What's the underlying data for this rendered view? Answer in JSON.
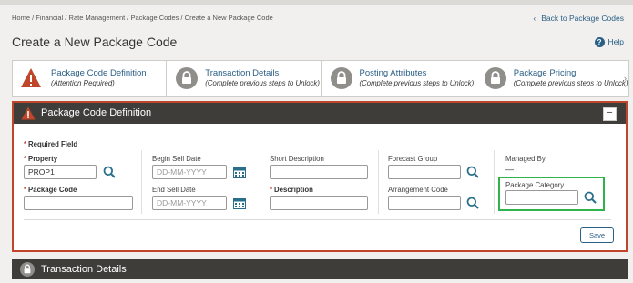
{
  "breadcrumb": "Home / Financial / Rate Management / Package Codes / Create a New Package Code",
  "back_link": "Back to Package Codes",
  "page_title": "Create a New Package Code",
  "help_label": "Help",
  "steps": [
    {
      "label": "Package Code Definition",
      "sub": "(Attention Required)",
      "icon": "warning-icon"
    },
    {
      "label": "Transaction Details",
      "sub": "(Complete previous steps to Unlock)",
      "icon": "lock-icon"
    },
    {
      "label": "Posting Attributes",
      "sub": "(Complete previous steps to Unlock)",
      "icon": "lock-icon"
    },
    {
      "label": "Package Pricing",
      "sub": "(Complete previous steps to Unlock)",
      "icon": "lock-icon"
    }
  ],
  "panel": {
    "title": "Package Code Definition",
    "required_note": "Required Field",
    "property_label": "Property",
    "property_value": "PROP1",
    "package_code_label": "Package Code",
    "package_code_value": "",
    "begin_sell_label": "Begin Sell Date",
    "begin_sell_placeholder": "DD-MM-YYYY",
    "end_sell_label": "End Sell Date",
    "end_sell_placeholder": "DD-MM-YYYY",
    "short_desc_label": "Short Description",
    "description_label": "Description",
    "forecast_group_label": "Forecast Group",
    "arrangement_code_label": "Arrangement Code",
    "managed_by_label": "Managed By",
    "managed_by_value": "—",
    "package_category_label": "Package Category",
    "save_label": "Save"
  },
  "bottom_panel_title": "Transaction Details",
  "colors": {
    "accent": "#2a5f86",
    "error": "#c0462b",
    "highlight": "#2fb34a",
    "header": "#3e3d3a"
  }
}
